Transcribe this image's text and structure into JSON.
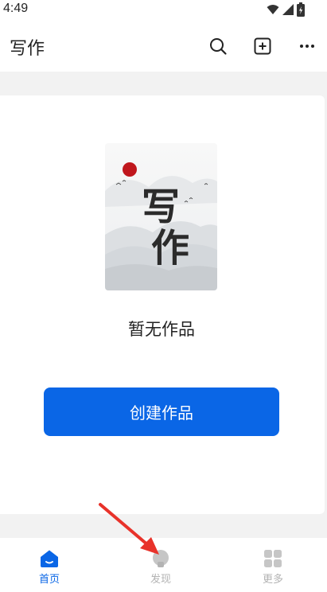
{
  "status_bar": {
    "time": "4:49"
  },
  "app_bar": {
    "title": "写作"
  },
  "cover": {
    "title_line1": "写",
    "title_line2": "作"
  },
  "empty_state": {
    "message": "暂无作品"
  },
  "create_button": {
    "label": "创建作品"
  },
  "bottom_nav": {
    "items": [
      {
        "label": "首页",
        "active": true
      },
      {
        "label": "发现",
        "active": false
      },
      {
        "label": "更多",
        "active": false
      }
    ]
  },
  "colors": {
    "accent": "#0a66e6",
    "inactive": "#b3b3b3",
    "annotation_arrow": "#e8322a"
  }
}
